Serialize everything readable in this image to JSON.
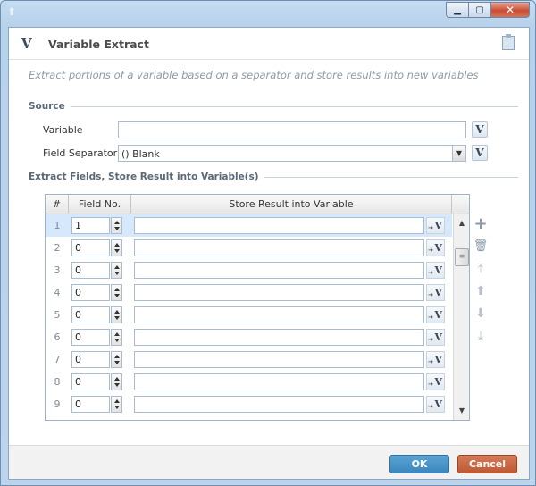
{
  "window": {
    "minimize_glyph": "▁",
    "maximize_glyph": "▢",
    "close_glyph": "✕",
    "app_glyph": "⬆"
  },
  "header": {
    "logo": "V",
    "title": "Variable Extract",
    "note_icon": "notepad-icon"
  },
  "description": "Extract portions of  a variable based on a separator and store results into new variables",
  "source": {
    "section_label": "Source",
    "variable_label": "Variable",
    "variable_value": "",
    "separator_label": "Field Separator",
    "separator_value": "() Blank",
    "var_button": "V"
  },
  "extract": {
    "section_label": "Extract Fields, Store Result into Variable(s)",
    "columns": [
      "#",
      "Field No.",
      "Store Result into Variable"
    ],
    "var_button": "V",
    "rows": [
      {
        "num": "1",
        "field": "1",
        "store": "",
        "selected": true
      },
      {
        "num": "2",
        "field": "0",
        "store": ""
      },
      {
        "num": "3",
        "field": "0",
        "store": ""
      },
      {
        "num": "4",
        "field": "0",
        "store": ""
      },
      {
        "num": "5",
        "field": "0",
        "store": ""
      },
      {
        "num": "6",
        "field": "0",
        "store": ""
      },
      {
        "num": "7",
        "field": "0",
        "store": ""
      },
      {
        "num": "8",
        "field": "0",
        "store": ""
      },
      {
        "num": "9",
        "field": "0",
        "store": ""
      }
    ],
    "scroll": {
      "up": "▲",
      "down": "▼",
      "grip": "≡"
    }
  },
  "tools": {
    "add": "+",
    "delete": "🗑",
    "top": "⤒",
    "up": "⬆",
    "down": "⬇",
    "bottom": "⤓"
  },
  "footer": {
    "ok": "OK",
    "cancel": "Cancel"
  },
  "colors": {
    "ok": "#3b87bd",
    "cancel": "#bd5a33",
    "selected_row": "#d6e8fb"
  }
}
